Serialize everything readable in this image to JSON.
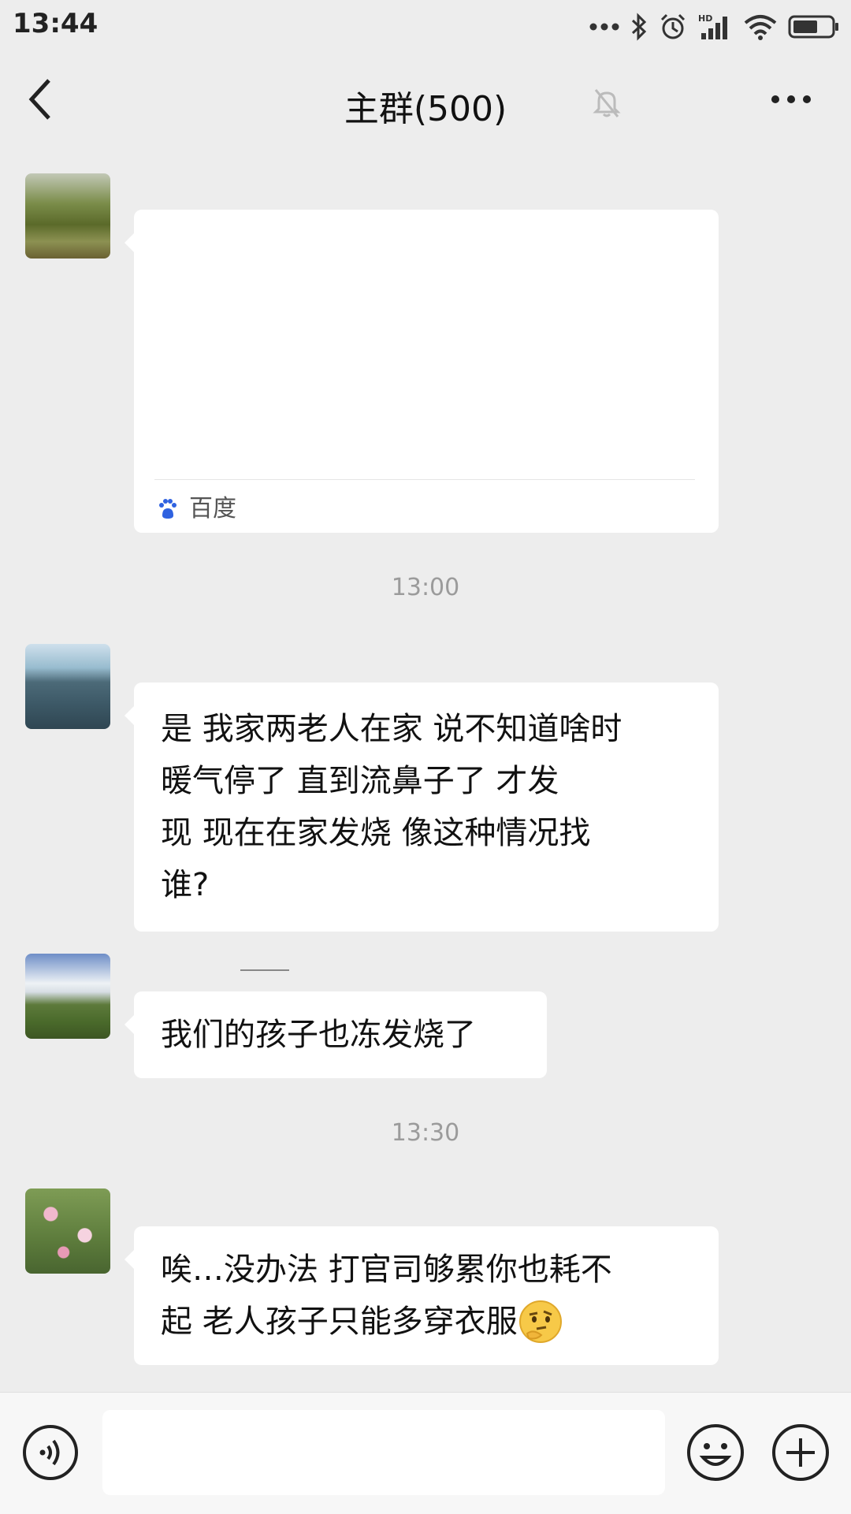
{
  "status_bar": {
    "time": "13:44",
    "icons": [
      "more-dots-icon",
      "bluetooth-icon",
      "alarm-icon",
      "hd-signal-icon",
      "wifi-icon",
      "battery-icon"
    ]
  },
  "header": {
    "title": "主群(500)",
    "back_icon": "back-chevron-icon",
    "mute_icon": "bell-muted-icon",
    "more_icon": "more-icon"
  },
  "messages": [
    {
      "type": "card",
      "card_body": "",
      "card_source": "百度",
      "source_icon": "baidu-paw-icon"
    },
    {
      "type": "timestamp",
      "text": "13:00"
    },
    {
      "type": "text",
      "lines": [
        "是  我家两老人在家  说不知道啥时",
        "暖气停了   直到流鼻子了    才发",
        "现   现在在家发烧    像这种情况找",
        "谁?"
      ]
    },
    {
      "type": "text",
      "text": "我们的孩子也冻发烧了"
    },
    {
      "type": "timestamp",
      "text": "13:30"
    },
    {
      "type": "text",
      "lines": [
        "唉…没办法 打官司够累你也耗不",
        "起 老人孩子只能多穿衣服"
      ],
      "emoji": "thinking-face-emoji"
    }
  ],
  "input_bar": {
    "placeholder": "",
    "voice_icon": "voice-icon",
    "emoji_icon": "emoji-icon",
    "plus_icon": "plus-icon"
  },
  "colors": {
    "background": "#ededed",
    "bubble": "#ffffff",
    "timestamp": "#9b9b9b",
    "baidu_blue": "#2f62e0"
  }
}
